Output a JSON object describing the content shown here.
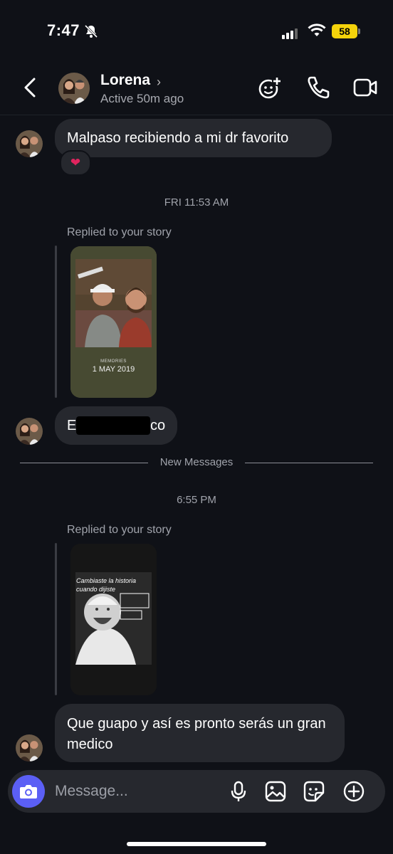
{
  "status_bar": {
    "time": "7:47",
    "battery": "58"
  },
  "header": {
    "name": "Lorena",
    "chevron": "›",
    "active": "Active 50m ago"
  },
  "messages": {
    "m1": "Malpaso recibiendo  a mi dr favorito",
    "m1_reaction": "❤",
    "ts1": "FRI 11:53 AM",
    "replied1": "Replied to your story",
    "story1_date_label": "MEMORIES",
    "story1_date": "1 MAY 2019",
    "m2_visible": "E",
    "m2_tail": "co",
    "new_messages": "New Messages",
    "ts2": "6:55 PM",
    "replied2": "Replied to your story",
    "story2_text": "Cambiaste la historia cuando dijiste",
    "m3": "Que  guapo  y así es pronto  serás un gran  medico"
  },
  "composer": {
    "placeholder": "Message..."
  },
  "colors": {
    "accent": "#5b5ff5",
    "bubble": "#26282e",
    "background": "#0f1117",
    "battery": "#f5d30b"
  }
}
